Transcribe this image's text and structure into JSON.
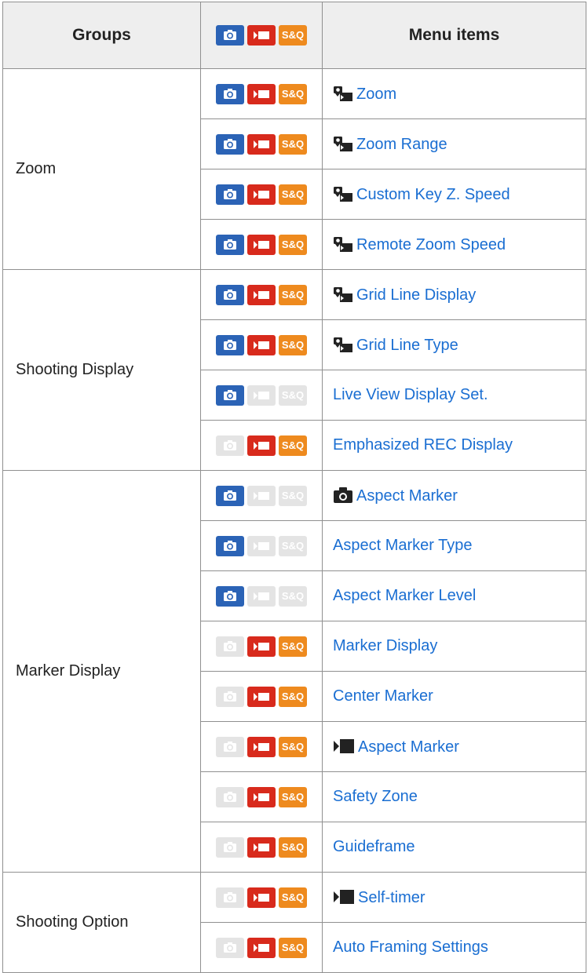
{
  "headers": {
    "groups": "Groups",
    "menu_items": "Menu items",
    "mode_icons": [
      "photo-mode-icon",
      "movie-mode-icon",
      "s-and-q-mode-icon"
    ],
    "sq_text": "S&Q"
  },
  "colors": {
    "photo": "#2b63b6",
    "movie": "#d82a1c",
    "sq": "#ee8a1e",
    "inactive": "#e4e4e4",
    "link": "#1a6ed2"
  },
  "groups": [
    {
      "label": "Zoom",
      "rows": [
        {
          "modes": [
            true,
            true,
            true
          ],
          "icon": "zoom-camera-icon",
          "label": "Zoom"
        },
        {
          "modes": [
            true,
            true,
            true
          ],
          "icon": "zoom-camera-icon",
          "label": "Zoom Range"
        },
        {
          "modes": [
            true,
            true,
            true
          ],
          "icon": "zoom-camera-icon",
          "label": "Custom Key Z. Speed"
        },
        {
          "modes": [
            true,
            true,
            true
          ],
          "icon": "zoom-camera-icon",
          "label": "Remote Zoom Speed"
        }
      ]
    },
    {
      "label": "Shooting Display",
      "rows": [
        {
          "modes": [
            true,
            true,
            true
          ],
          "icon": "zoom-camera-icon",
          "label": "Grid Line Display"
        },
        {
          "modes": [
            true,
            true,
            true
          ],
          "icon": "zoom-camera-icon",
          "label": "Grid Line Type"
        },
        {
          "modes": [
            true,
            false,
            false
          ],
          "icon": "",
          "label": "Live View Display Set."
        },
        {
          "modes": [
            false,
            true,
            true
          ],
          "icon": "",
          "label": "Emphasized REC Display"
        }
      ]
    },
    {
      "label": "Marker Display",
      "rows": [
        {
          "modes": [
            true,
            false,
            false
          ],
          "icon": "still-camera-icon",
          "label": "Aspect Marker"
        },
        {
          "modes": [
            true,
            false,
            false
          ],
          "icon": "",
          "label": "Aspect Marker Type"
        },
        {
          "modes": [
            true,
            false,
            false
          ],
          "icon": "",
          "label": "Aspect Marker Level"
        },
        {
          "modes": [
            false,
            true,
            true
          ],
          "icon": "",
          "label": "Marker Display"
        },
        {
          "modes": [
            false,
            true,
            true
          ],
          "icon": "",
          "label": "Center Marker"
        },
        {
          "modes": [
            false,
            true,
            true
          ],
          "icon": "movie-camera-icon",
          "label": "Aspect Marker"
        },
        {
          "modes": [
            false,
            true,
            true
          ],
          "icon": "",
          "label": "Safety Zone"
        },
        {
          "modes": [
            false,
            true,
            true
          ],
          "icon": "",
          "label": "Guideframe"
        }
      ]
    },
    {
      "label": "Shooting Option",
      "rows": [
        {
          "modes": [
            false,
            true,
            true
          ],
          "icon": "movie-camera-icon",
          "label": "Self-timer"
        },
        {
          "modes": [
            false,
            true,
            true
          ],
          "icon": "",
          "label": "Auto Framing Settings"
        }
      ]
    }
  ]
}
